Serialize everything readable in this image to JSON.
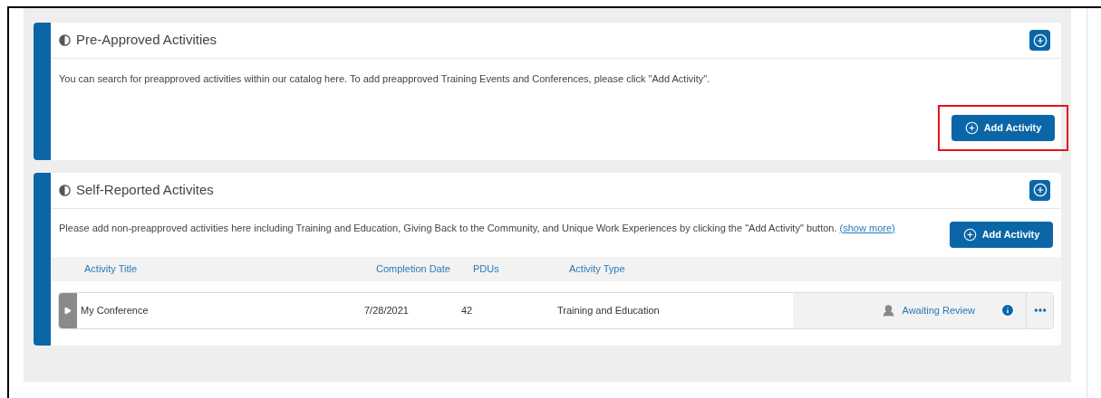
{
  "sections": [
    {
      "title": "Pre-Approved Activities",
      "description": "You can search for preapproved activities within our catalog here. To add preapproved Training Events and Conferences, please click \"Add Activity\".",
      "button": {
        "label": "Add Activity",
        "highlighted": true
      },
      "kind": "catalog"
    },
    {
      "title": "Self-Reported Activites",
      "description": "Please add non-preapproved activities here including Training and Education, Giving Back to the Community, and Unique Work Experiences by clicking the \"Add Activity\" button.",
      "link": "(show more)",
      "button": {
        "label": "Add Activity",
        "highlighted": false
      },
      "kind": "self_reported",
      "table": {
        "columns": [
          "Activity Title",
          "Completion Date",
          "PDUs",
          "Activity Type"
        ],
        "rows": [
          {
            "cells": [
              "My Conference",
              "7/28/2021",
              "42",
              "Training and Education"
            ],
            "expanded": false,
            "status": "Awaiting Review"
          }
        ]
      }
    }
  ]
}
